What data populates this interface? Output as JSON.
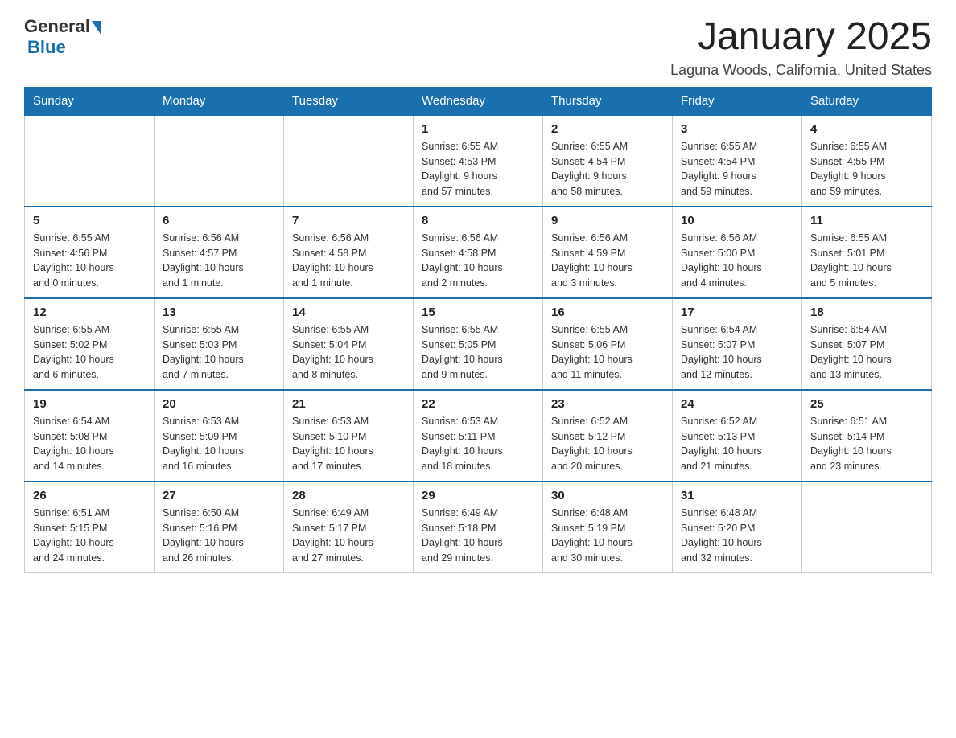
{
  "header": {
    "logo": {
      "general": "General",
      "blue": "Blue"
    },
    "title": "January 2025",
    "location": "Laguna Woods, California, United States"
  },
  "weekdays": [
    "Sunday",
    "Monday",
    "Tuesday",
    "Wednesday",
    "Thursday",
    "Friday",
    "Saturday"
  ],
  "weeks": [
    [
      {
        "day": "",
        "info": ""
      },
      {
        "day": "",
        "info": ""
      },
      {
        "day": "",
        "info": ""
      },
      {
        "day": "1",
        "info": "Sunrise: 6:55 AM\nSunset: 4:53 PM\nDaylight: 9 hours\nand 57 minutes."
      },
      {
        "day": "2",
        "info": "Sunrise: 6:55 AM\nSunset: 4:54 PM\nDaylight: 9 hours\nand 58 minutes."
      },
      {
        "day": "3",
        "info": "Sunrise: 6:55 AM\nSunset: 4:54 PM\nDaylight: 9 hours\nand 59 minutes."
      },
      {
        "day": "4",
        "info": "Sunrise: 6:55 AM\nSunset: 4:55 PM\nDaylight: 9 hours\nand 59 minutes."
      }
    ],
    [
      {
        "day": "5",
        "info": "Sunrise: 6:55 AM\nSunset: 4:56 PM\nDaylight: 10 hours\nand 0 minutes."
      },
      {
        "day": "6",
        "info": "Sunrise: 6:56 AM\nSunset: 4:57 PM\nDaylight: 10 hours\nand 1 minute."
      },
      {
        "day": "7",
        "info": "Sunrise: 6:56 AM\nSunset: 4:58 PM\nDaylight: 10 hours\nand 1 minute."
      },
      {
        "day": "8",
        "info": "Sunrise: 6:56 AM\nSunset: 4:58 PM\nDaylight: 10 hours\nand 2 minutes."
      },
      {
        "day": "9",
        "info": "Sunrise: 6:56 AM\nSunset: 4:59 PM\nDaylight: 10 hours\nand 3 minutes."
      },
      {
        "day": "10",
        "info": "Sunrise: 6:56 AM\nSunset: 5:00 PM\nDaylight: 10 hours\nand 4 minutes."
      },
      {
        "day": "11",
        "info": "Sunrise: 6:55 AM\nSunset: 5:01 PM\nDaylight: 10 hours\nand 5 minutes."
      }
    ],
    [
      {
        "day": "12",
        "info": "Sunrise: 6:55 AM\nSunset: 5:02 PM\nDaylight: 10 hours\nand 6 minutes."
      },
      {
        "day": "13",
        "info": "Sunrise: 6:55 AM\nSunset: 5:03 PM\nDaylight: 10 hours\nand 7 minutes."
      },
      {
        "day": "14",
        "info": "Sunrise: 6:55 AM\nSunset: 5:04 PM\nDaylight: 10 hours\nand 8 minutes."
      },
      {
        "day": "15",
        "info": "Sunrise: 6:55 AM\nSunset: 5:05 PM\nDaylight: 10 hours\nand 9 minutes."
      },
      {
        "day": "16",
        "info": "Sunrise: 6:55 AM\nSunset: 5:06 PM\nDaylight: 10 hours\nand 11 minutes."
      },
      {
        "day": "17",
        "info": "Sunrise: 6:54 AM\nSunset: 5:07 PM\nDaylight: 10 hours\nand 12 minutes."
      },
      {
        "day": "18",
        "info": "Sunrise: 6:54 AM\nSunset: 5:07 PM\nDaylight: 10 hours\nand 13 minutes."
      }
    ],
    [
      {
        "day": "19",
        "info": "Sunrise: 6:54 AM\nSunset: 5:08 PM\nDaylight: 10 hours\nand 14 minutes."
      },
      {
        "day": "20",
        "info": "Sunrise: 6:53 AM\nSunset: 5:09 PM\nDaylight: 10 hours\nand 16 minutes."
      },
      {
        "day": "21",
        "info": "Sunrise: 6:53 AM\nSunset: 5:10 PM\nDaylight: 10 hours\nand 17 minutes."
      },
      {
        "day": "22",
        "info": "Sunrise: 6:53 AM\nSunset: 5:11 PM\nDaylight: 10 hours\nand 18 minutes."
      },
      {
        "day": "23",
        "info": "Sunrise: 6:52 AM\nSunset: 5:12 PM\nDaylight: 10 hours\nand 20 minutes."
      },
      {
        "day": "24",
        "info": "Sunrise: 6:52 AM\nSunset: 5:13 PM\nDaylight: 10 hours\nand 21 minutes."
      },
      {
        "day": "25",
        "info": "Sunrise: 6:51 AM\nSunset: 5:14 PM\nDaylight: 10 hours\nand 23 minutes."
      }
    ],
    [
      {
        "day": "26",
        "info": "Sunrise: 6:51 AM\nSunset: 5:15 PM\nDaylight: 10 hours\nand 24 minutes."
      },
      {
        "day": "27",
        "info": "Sunrise: 6:50 AM\nSunset: 5:16 PM\nDaylight: 10 hours\nand 26 minutes."
      },
      {
        "day": "28",
        "info": "Sunrise: 6:49 AM\nSunset: 5:17 PM\nDaylight: 10 hours\nand 27 minutes."
      },
      {
        "day": "29",
        "info": "Sunrise: 6:49 AM\nSunset: 5:18 PM\nDaylight: 10 hours\nand 29 minutes."
      },
      {
        "day": "30",
        "info": "Sunrise: 6:48 AM\nSunset: 5:19 PM\nDaylight: 10 hours\nand 30 minutes."
      },
      {
        "day": "31",
        "info": "Sunrise: 6:48 AM\nSunset: 5:20 PM\nDaylight: 10 hours\nand 32 minutes."
      },
      {
        "day": "",
        "info": ""
      }
    ]
  ]
}
